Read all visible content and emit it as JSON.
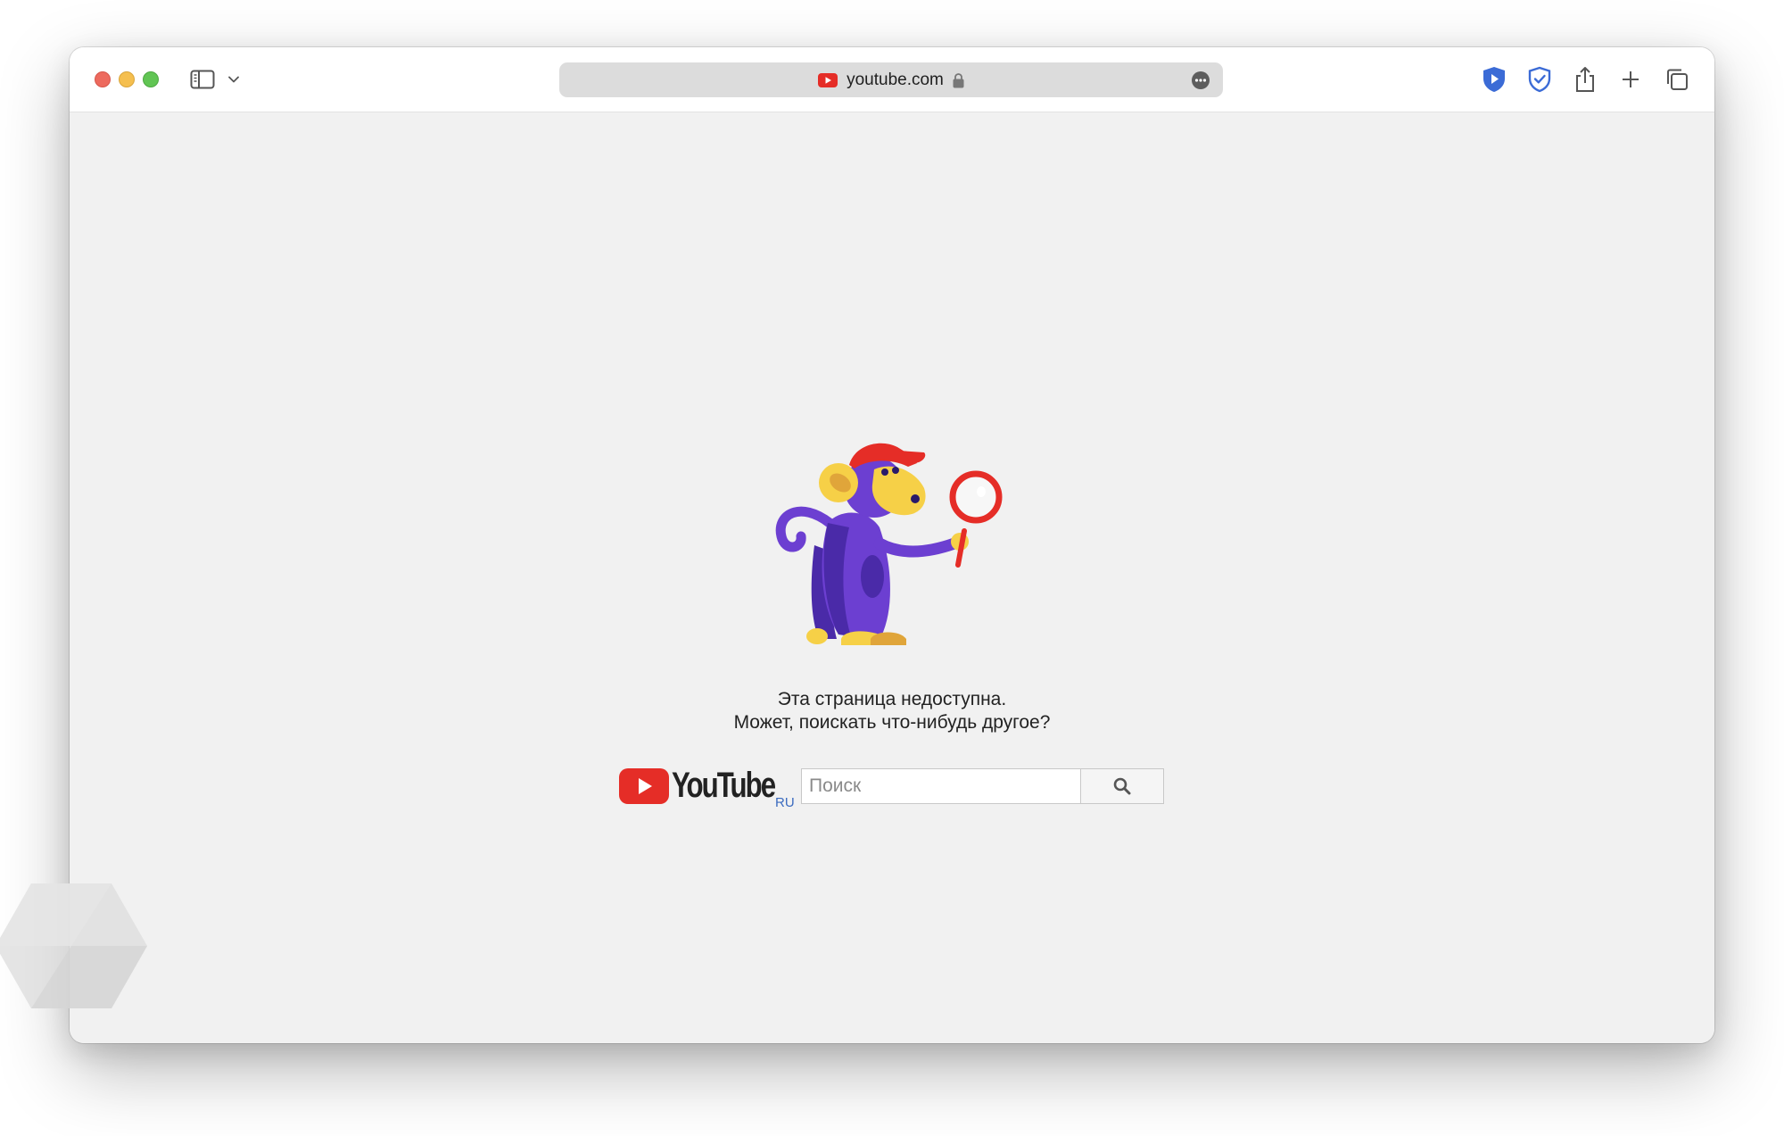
{
  "browser": {
    "address": "youtube.com",
    "colors": {
      "accent_blue": "#3b6bd6",
      "yt_red": "#e52d27"
    },
    "toolbar_icons": [
      "sidebar-icon",
      "chevron-down-icon",
      "youtube-favicon-icon",
      "lock-icon",
      "more-icon",
      "privacy-shield-icon",
      "adblock-shield-icon",
      "share-icon",
      "new-tab-plus-icon",
      "tabs-overview-icon"
    ]
  },
  "page": {
    "message_line1": "Эта страница недоступна.",
    "message_line2": "Может, поискать что-нибудь другое?",
    "logo_text": "YouTube",
    "logo_region": "RU",
    "search_placeholder": "Поиск"
  }
}
